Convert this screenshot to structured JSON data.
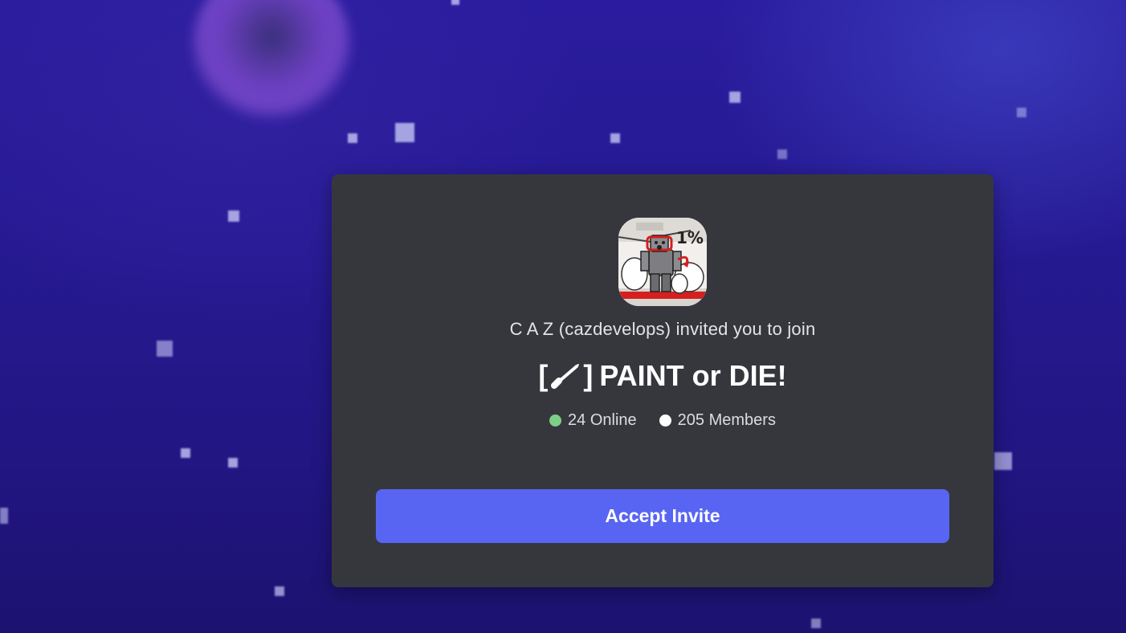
{
  "invite": {
    "inviter_text": "C A Z (cazdevelops) invited you to join",
    "server_name": "PAINT or DIE!",
    "bracket_open": "[",
    "bracket_close": "]",
    "brush_icon": "paintbrush-icon",
    "online_count_text": "24 Online",
    "members_count_text": "205 Members",
    "accept_label": "Accept Invite",
    "server_icon_text": "1%"
  },
  "colors": {
    "accent": "#5865f2",
    "card_bg": "#36373d",
    "online_dot": "#7dcf88",
    "members_dot": "#ffffff"
  }
}
